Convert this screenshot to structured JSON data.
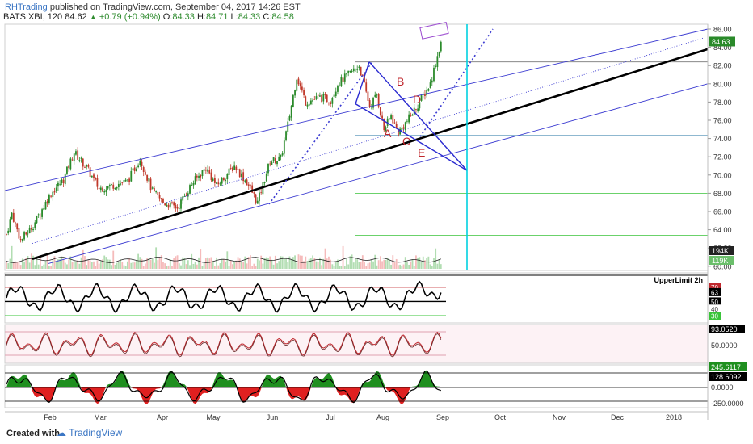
{
  "header": {
    "brand": "RHTrading",
    "published": "published on TradingView.com, September 04, 2017 14:26 EST",
    "symbol": "BATS:XBI, 120",
    "last": "84.62",
    "change": "+0.79 (+0.94%)",
    "ohlc_o_label": "O:",
    "ohlc_o": "84.33",
    "ohlc_h_label": "H:",
    "ohlc_h": "84.71",
    "ohlc_l_label": "L:",
    "ohlc_l": "84.33",
    "ohlc_c_label": "C:",
    "ohlc_c": "84.58"
  },
  "footer": {
    "created_with": "Created with",
    "brand": "TradingView"
  },
  "colors": {
    "up": "#2a8a2a",
    "down": "#c0392b",
    "channel": "#3b3bd1",
    "trend": "#000000",
    "wedge": "#2a2ad0",
    "cyan": "#00d0e0",
    "pattern_label": "#c0272d",
    "level": "#6aa0c0",
    "green_level": "#3ac43a",
    "oscillator_fill_pos": "#1f8f1f",
    "oscillator_fill_neg": "#e02020"
  },
  "chart_data": {
    "type": "candlestick",
    "symbol": "BATS:XBI",
    "interval": "120",
    "x_ticks": [
      "Feb",
      "Mar",
      "Apr",
      "May",
      "Jun",
      "Jul",
      "Aug",
      "Sep",
      "Oct",
      "Nov",
      "Dec",
      "2018"
    ],
    "y_ticks": [
      "86.00",
      "84.00",
      "82.00",
      "80.00",
      "78.00",
      "76.00",
      "74.00",
      "72.00",
      "70.00",
      "68.00",
      "66.00",
      "64.00",
      "62.00",
      "60.00"
    ],
    "ylim": [
      60,
      86
    ],
    "price_path": [
      [
        0,
        63.5
      ],
      [
        3,
        65.8
      ],
      [
        8,
        62.8
      ],
      [
        15,
        64.5
      ],
      [
        25,
        68
      ],
      [
        32,
        69.5
      ],
      [
        38,
        72.5
      ],
      [
        45,
        70.8
      ],
      [
        52,
        68.5
      ],
      [
        58,
        68.8
      ],
      [
        68,
        69.3
      ],
      [
        75,
        71.8
      ],
      [
        82,
        68.2
      ],
      [
        88,
        67
      ],
      [
        96,
        66.4
      ],
      [
        104,
        69
      ],
      [
        112,
        70.8
      ],
      [
        118,
        68.8
      ],
      [
        128,
        71
      ],
      [
        135,
        69.2
      ],
      [
        141,
        67
      ],
      [
        148,
        71.5
      ],
      [
        154,
        71.8
      ],
      [
        158,
        75.5
      ],
      [
        163,
        80.8
      ],
      [
        168,
        78
      ],
      [
        176,
        78.5
      ],
      [
        182,
        78.2
      ],
      [
        186,
        80
      ],
      [
        192,
        81
      ],
      [
        198,
        82
      ],
      [
        204,
        77.5
      ],
      [
        208,
        78.8
      ],
      [
        212,
        75
      ],
      [
        216,
        76.5
      ],
      [
        220,
        74.6
      ],
      [
        226,
        76.2
      ],
      [
        232,
        78
      ],
      [
        238,
        80
      ],
      [
        244,
        84.6
      ]
    ],
    "last_price": "84.63",
    "volume_axis_labels": [
      "194K",
      "119K"
    ],
    "rsi": {
      "levels": [
        "70",
        "63",
        "50",
        "40",
        "30"
      ],
      "right_label": "UpperLimit 2h"
    },
    "oscillator2": {
      "levels": [
        "93.0520",
        "50.0000"
      ]
    },
    "oscillator3": {
      "levels": [
        "245.6117",
        "128.6092",
        "0.0000",
        "-250.0000"
      ]
    },
    "annotations": {
      "pattern_labels": [
        "A",
        "B",
        "C",
        "D",
        "E"
      ]
    }
  }
}
